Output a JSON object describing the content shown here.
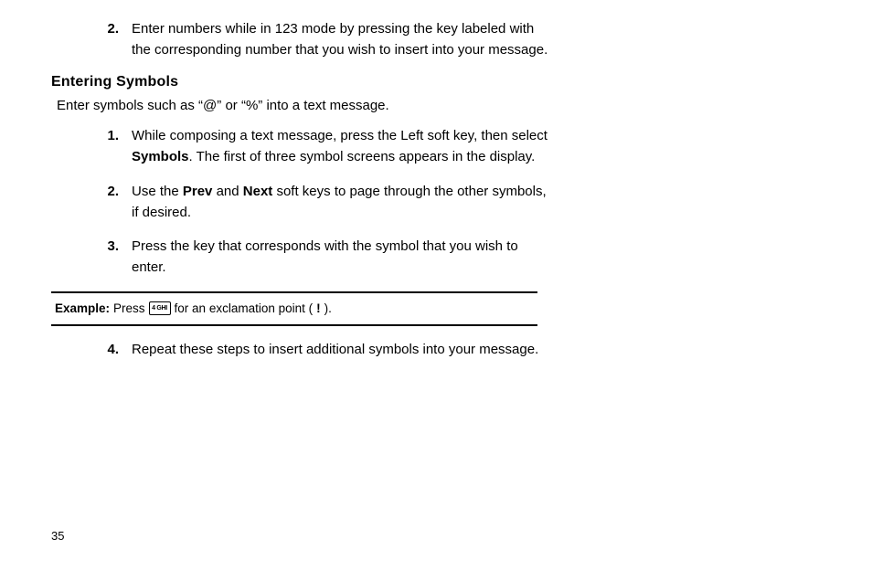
{
  "top_list": {
    "items": [
      {
        "num": "2.",
        "text": "Enter numbers while in 123 mode by pressing the key labeled with the corresponding number that you wish to insert into your message."
      }
    ]
  },
  "section": {
    "heading": "Entering Symbols",
    "intro": "Enter symbols such as “@” or “%” into a text message."
  },
  "steps": {
    "items": [
      {
        "num": "1.",
        "pre": "While composing a text message, press the Left soft key, then select ",
        "bold": "Symbols",
        "post": ". The first of three symbol screens appears in the display."
      },
      {
        "num": "2.",
        "pre": "Use the ",
        "bold": "Prev",
        "mid": " and ",
        "bold2": "Next",
        "post": " soft keys to page through the other symbols, if desired."
      },
      {
        "num": "3.",
        "text": "Press the key that corresponds with the symbol that you wish to enter."
      }
    ]
  },
  "example": {
    "label": "Example:",
    "pre": "Press",
    "key": "4 GHI",
    "post_a": "for an exclamation point (",
    "bold": "!",
    "post_b": ")."
  },
  "after": {
    "items": [
      {
        "num": "4.",
        "text": "Repeat these steps to insert additional symbols into your message."
      }
    ]
  },
  "page_number": "35"
}
